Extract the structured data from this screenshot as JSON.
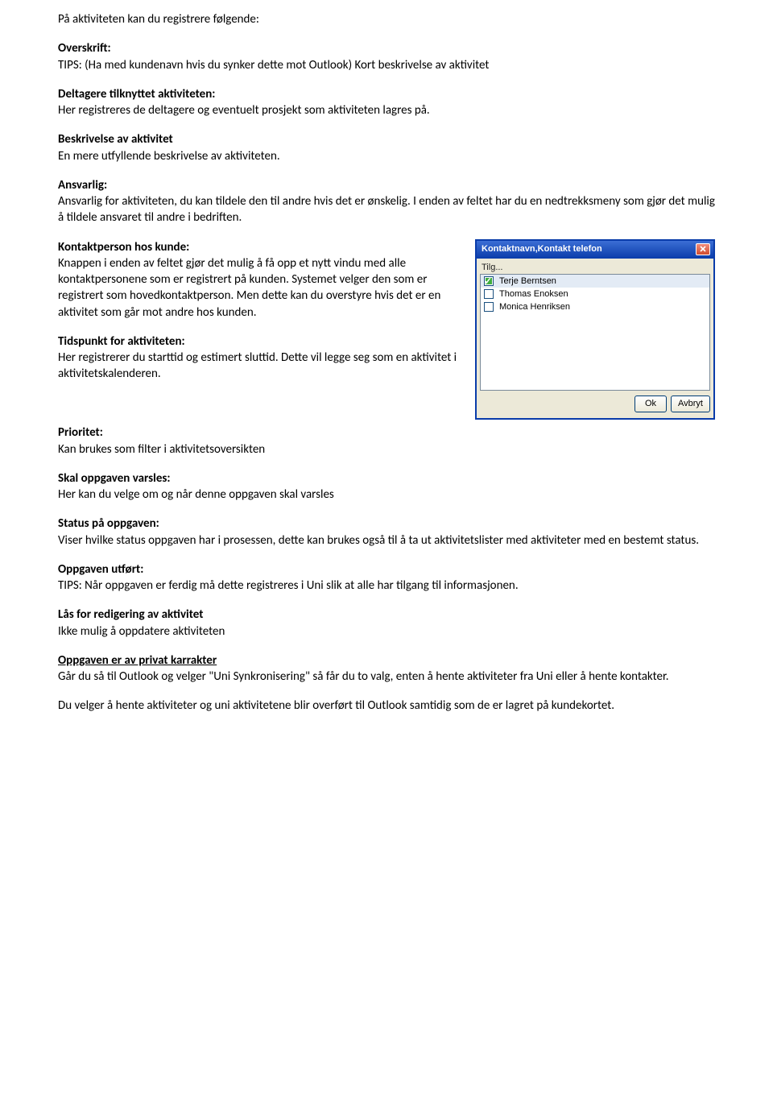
{
  "intro": "På aktiviteten kan du registrere følgende:",
  "sections": {
    "overskrift": {
      "label": "Overskrift:",
      "text": "TIPS: (Ha med kundenavn hvis du synker dette mot Outlook) Kort beskrivelse av aktivitet"
    },
    "deltagere": {
      "label": "Deltagere tilknyttet aktiviteten:",
      "text": "Her registreres de deltagere og eventuelt prosjekt som aktiviteten lagres på."
    },
    "beskrivelse": {
      "label": "Beskrivelse av aktivitet",
      "text": "En mere utfyllende beskrivelse av aktiviteten."
    },
    "ansvarlig": {
      "label": "Ansvarlig:",
      "text": "Ansvarlig for aktiviteten, du kan tildele den til andre hvis det er ønskelig. I enden av feltet har du en nedtrekksmeny som gjør det mulig å tildele ansvaret til andre i bedriften."
    },
    "kontaktperson": {
      "label": "Kontaktperson hos kunde:",
      "text": "Knappen i enden av feltet gjør det mulig å få opp et nytt vindu med alle kontaktpersonene som er registrert på kunden. Systemet velger den som er registrert som hovedkontaktperson. Men dette kan du overstyre hvis det er en aktivitet som går mot andre hos kunden."
    },
    "tidspunkt": {
      "label": "Tidspunkt for aktiviteten:",
      "text": "Her registrerer du starttid og estimert sluttid. Dette vil legge seg som en aktivitet i aktivitetskalenderen."
    },
    "prioritet": {
      "label": "Prioritet:",
      "text": "Kan brukes som filter i aktivitetsoversikten"
    },
    "varsles": {
      "label": "Skal oppgaven varsles:",
      "text": "Her kan du velge om og når denne oppgaven skal varsles"
    },
    "status": {
      "label": "Status på oppgaven:",
      "text": "Viser hvilke status oppgaven har i prosessen, dette kan brukes også til å ta ut aktivitetslister med aktiviteter med en bestemt status."
    },
    "utfort": {
      "label": "Oppgaven utført:",
      "text": "TIPS: Når oppgaven er ferdig må dette registreres i Uni slik at alle har tilgang til informasjonen."
    },
    "las": {
      "label": "Lås for redigering av aktivitet",
      "text": "Ikke mulig å oppdatere aktiviteten"
    },
    "privat": {
      "label": "Oppgaven er av privat karrakter",
      "text": "Går du så til Outlook og velger \"Uni Synkronisering\" så får du to valg, enten å hente aktiviteter fra Uni eller å hente kontakter."
    }
  },
  "closing": "Du velger å hente aktiviteter og uni aktivitetene blir overført til Outlook samtidig som de er lagret på kundekortet.",
  "popup": {
    "title": "Kontaktnavn,Kontakt telefon",
    "tilg_label": "Tilg...",
    "rows": [
      {
        "checked": true,
        "name": "Terje Berntsen"
      },
      {
        "checked": false,
        "name": "Thomas Enoksen"
      },
      {
        "checked": false,
        "name": "Monica Henriksen"
      }
    ],
    "ok": "Ok",
    "cancel": "Avbryt"
  }
}
